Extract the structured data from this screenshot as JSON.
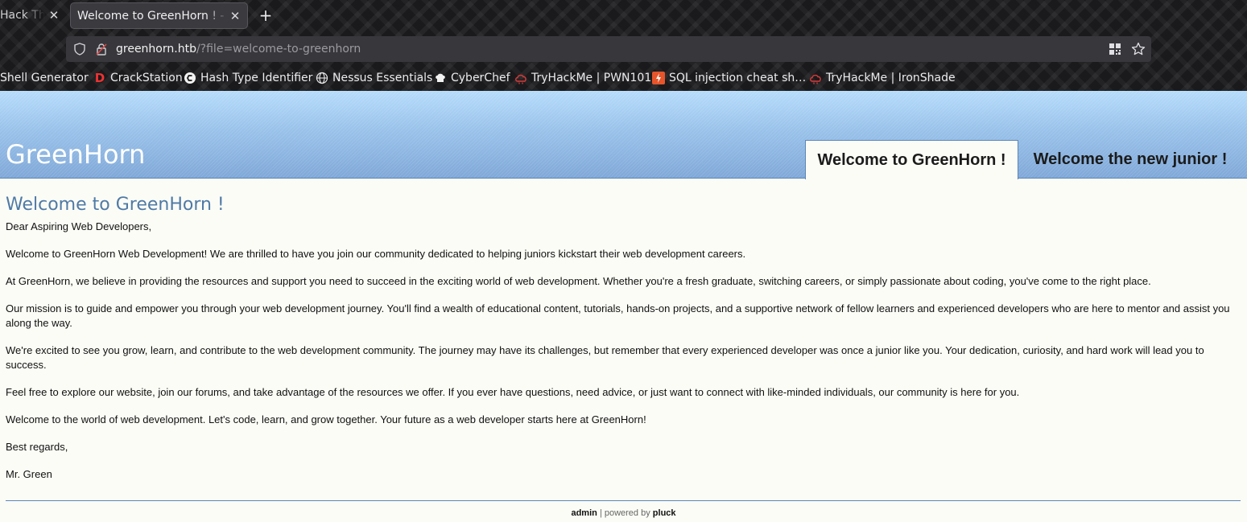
{
  "browser": {
    "tabs": [
      {
        "title": "Hack The Box",
        "active": false
      },
      {
        "title": "Welcome to GreenHorn ! - GreenHorn",
        "active": true
      }
    ],
    "url": {
      "host": "greenhorn.htb",
      "path": "/?file=welcome-to-greenhorn"
    },
    "bookmarks": [
      {
        "label": "Shell Generator",
        "icon": "none"
      },
      {
        "label": "CrackStation",
        "icon": "crackstation-d-icon"
      },
      {
        "label": "Hash Type Identifier",
        "icon": "hash-identifier-icon"
      },
      {
        "label": "Nessus Essentials",
        "icon": "globe-icon"
      },
      {
        "label": "CyberChef",
        "icon": "chef-hat-icon"
      },
      {
        "label": "TryHackMe | PWN101",
        "icon": "tryhackme-icon"
      },
      {
        "label": "SQL injection cheat sh…",
        "icon": "portswigger-icon"
      },
      {
        "label": "TryHackMe | IronShade",
        "icon": "tryhackme-icon"
      }
    ]
  },
  "site": {
    "title": "GreenHorn",
    "nav": [
      {
        "label": "Welcome to GreenHorn !",
        "active": true
      },
      {
        "label": "Welcome the new junior !",
        "active": false
      }
    ]
  },
  "article": {
    "heading": "Welcome to GreenHorn !",
    "paragraphs": [
      "Dear Aspiring Web Developers,",
      "Welcome to GreenHorn Web Development! We are thrilled to have you join our community dedicated to helping juniors kickstart their web development careers.",
      "At GreenHorn, we believe in providing the resources and support you need to succeed in the exciting world of web development. Whether you're a fresh graduate, switching careers, or simply passionate about coding, you've come to the right place.",
      "Our mission is to guide and empower you through your web development journey. You'll find a wealth of educational content, tutorials, hands-on projects, and a supportive network of fellow learners and experienced developers who are here to mentor and assist you along the way.",
      "We're excited to see you grow, learn, and contribute to the web development community. The journey may have its challenges, but remember that every experienced developer was once a junior like you. Your dedication, curiosity, and hard work will lead you to success.",
      "Feel free to explore our website, join our forums, and take advantage of the resources we offer. If you ever have questions, need advice, or just want to connect with like-minded individuals, our community is here for you.",
      "Welcome to the world of web development. Let's code, learn, and grow together. Your future as a web developer starts here at GreenHorn!",
      "Best regards,",
      "Mr. Green"
    ]
  },
  "footer": {
    "admin_label": "admin",
    "separator": "| powered by",
    "cms_label": "pluck"
  },
  "colors": {
    "heading": "#4f7aa6",
    "header_gradient_top": "#b6dcfb",
    "header_gradient_bottom": "#80a8d8",
    "page_background": "#fbfcf6"
  }
}
